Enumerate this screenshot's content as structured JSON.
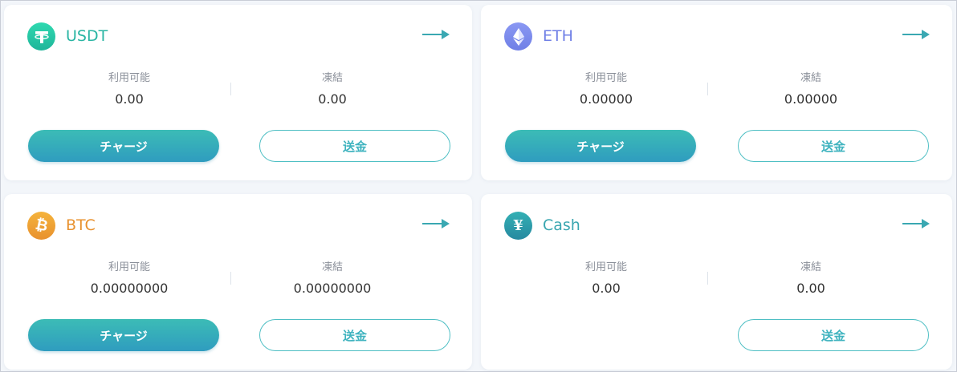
{
  "labels": {
    "available": "利用可能",
    "frozen": "凍結"
  },
  "cards": [
    {
      "name": "USDT",
      "icon": "tether-icon",
      "icon_color": "#26c8a0",
      "name_color": "#2ab5a3",
      "available": "0.00",
      "frozen": "0.00",
      "charge_label": "チャージ",
      "send_label": "送金"
    },
    {
      "name": "ETH",
      "icon": "ethereum-icon",
      "icon_color": "#7c8bee",
      "name_color": "#6f7fe6",
      "available": "0.00000",
      "frozen": "0.00000",
      "charge_label": "チャージ",
      "send_label": "送金"
    },
    {
      "name": "BTC",
      "icon": "bitcoin-icon",
      "icon_color": "#f0a02a",
      "name_color": "#e8912e",
      "available": "0.00000000",
      "frozen": "0.00000000",
      "charge_label": "チャージ",
      "send_label": "送金"
    },
    {
      "name": "Cash",
      "icon": "yen-icon",
      "icon_color": "#2b9aa6",
      "name_color": "#3aa6b0",
      "available": "0.00",
      "frozen": "0.00",
      "send_label": "送金"
    }
  ],
  "colors": {
    "accent_teal": "#3cbcb6",
    "accent_blue": "#2f9cbf",
    "arrow": "#3aa8b2"
  }
}
